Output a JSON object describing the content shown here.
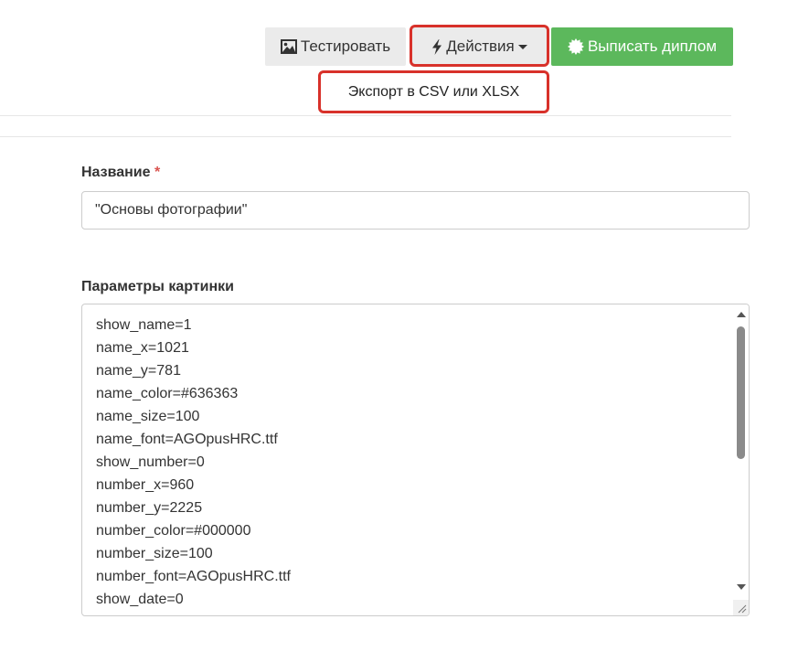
{
  "toolbar": {
    "test_label": "Тестировать",
    "actions_label": "Действия",
    "issue_label": "Выписать диплом",
    "issue_color": "#5cb85c",
    "highlight_color": "#d8312a"
  },
  "dropdown": {
    "items": [
      {
        "label": "Экспорт в CSV или XLSX"
      }
    ]
  },
  "form": {
    "name_label": "Название",
    "required_mark": "*",
    "name_value": "\"Основы фотографии\"",
    "params_label": "Параметры картинки",
    "params_lines": [
      "show_name=1",
      "name_x=1021",
      "name_y=781",
      "name_color=#636363",
      "name_size=100",
      "name_font=AGOpusHRC.ttf",
      "show_number=0",
      "number_x=960",
      "number_y=2225",
      "number_color=#000000",
      "number_size=100",
      "number_font=AGOpusHRC.ttf",
      "show_date=0"
    ]
  },
  "icons": {
    "test": "image-icon",
    "actions": "bolt-icon",
    "issue": "certificate-icon"
  }
}
